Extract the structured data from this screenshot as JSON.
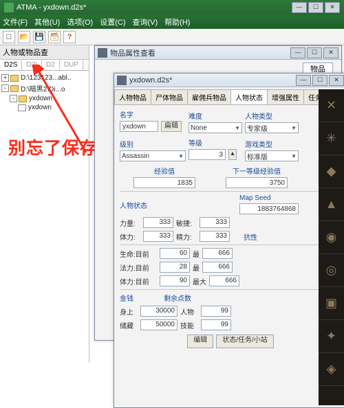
{
  "main_title": "ATMA - yxdown.d2s*",
  "menus": [
    "文件(F)",
    "其他(U)",
    "选项(O)",
    "设置(C)",
    "查询(V)",
    "帮助(H)"
  ],
  "toolbar_icons": {
    "new": "□",
    "open": "📂",
    "save": "💾",
    "save2": "🗃",
    "help": "?"
  },
  "side": {
    "title": "人物或物品查",
    "tabs": [
      "D2S",
      "D2I",
      "D2",
      "DUP"
    ],
    "tree": [
      {
        "exp": "+",
        "lvl": 0,
        "txt": "D:\\123123...abl..",
        "ico": "dir"
      },
      {
        "exp": "-",
        "lvl": 0,
        "txt": "D:\\暗黑2\\Di...o",
        "ico": "dir"
      },
      {
        "exp": "-",
        "lvl": 1,
        "txt": "yxdown",
        "ico": "dir"
      },
      {
        "exp": "",
        "lvl": 2,
        "txt": "yxdown",
        "ico": "file"
      }
    ]
  },
  "annotation": "别忘了保存",
  "attr_wnd": {
    "title": "物品属性查看",
    "tab": "物品"
  },
  "char_wnd": {
    "title": "yxdown.d2s*",
    "tabs": [
      "人物物品",
      "尸体物品",
      "雇佣兵物品",
      "人物状态",
      "增强属性",
      "任务和传送"
    ],
    "active_tab": 3,
    "name_lbl": "名字",
    "name_val": "yxdown",
    "name_btn": "扁辑",
    "diff_lbl": "难度",
    "diff_val": "None",
    "ctype_lbl": "人物类型",
    "ctype_val": "专家级",
    "class_lbl": "级别",
    "class_val": "Assassin",
    "level_lbl": "等级",
    "level_val": "3",
    "gtype_lbl": "游戏类型",
    "gtype_val": "标准版",
    "exp_lbl": "经验值",
    "exp_val": "1835",
    "nextexp_lbl": "下一等级经验值",
    "nextexp_val": "3750",
    "stats_lbl": "人物状态",
    "seed_lbl": "Map Seed",
    "seed_val": "1883764868",
    "str_lbl": "力量:",
    "str_val": "333",
    "dex_lbl": "敏捷:",
    "dex_val": "333",
    "vit_lbl": "体力:",
    "vit_val": "333",
    "eng_lbl": "精力:",
    "eng_val": "333",
    "res_lbl": "抗性",
    "life_lbl": "生命:目前",
    "life_cur": "60",
    "max_lbl": "最",
    "life_max": "666",
    "mana_lbl": "法力:目前",
    "mana_cur": "28",
    "mana_max": "666",
    "stam_lbl": "体力:目前",
    "stam_cur": "90",
    "max2_lbl": "最大",
    "stam_max": "666",
    "gold_lbl": "金钱",
    "remain_lbl": "剩余点数",
    "onbody_lbl": "身上",
    "onbody_val": "30000",
    "char_pt_lbl": "人物",
    "char_pt_val": "99",
    "stash_lbl": "储藏",
    "stash_val": "50000",
    "skill_pt_lbl": "技能",
    "skill_pt_val": "99",
    "footer": [
      "编辑",
      "状态/任务/小站"
    ]
  }
}
